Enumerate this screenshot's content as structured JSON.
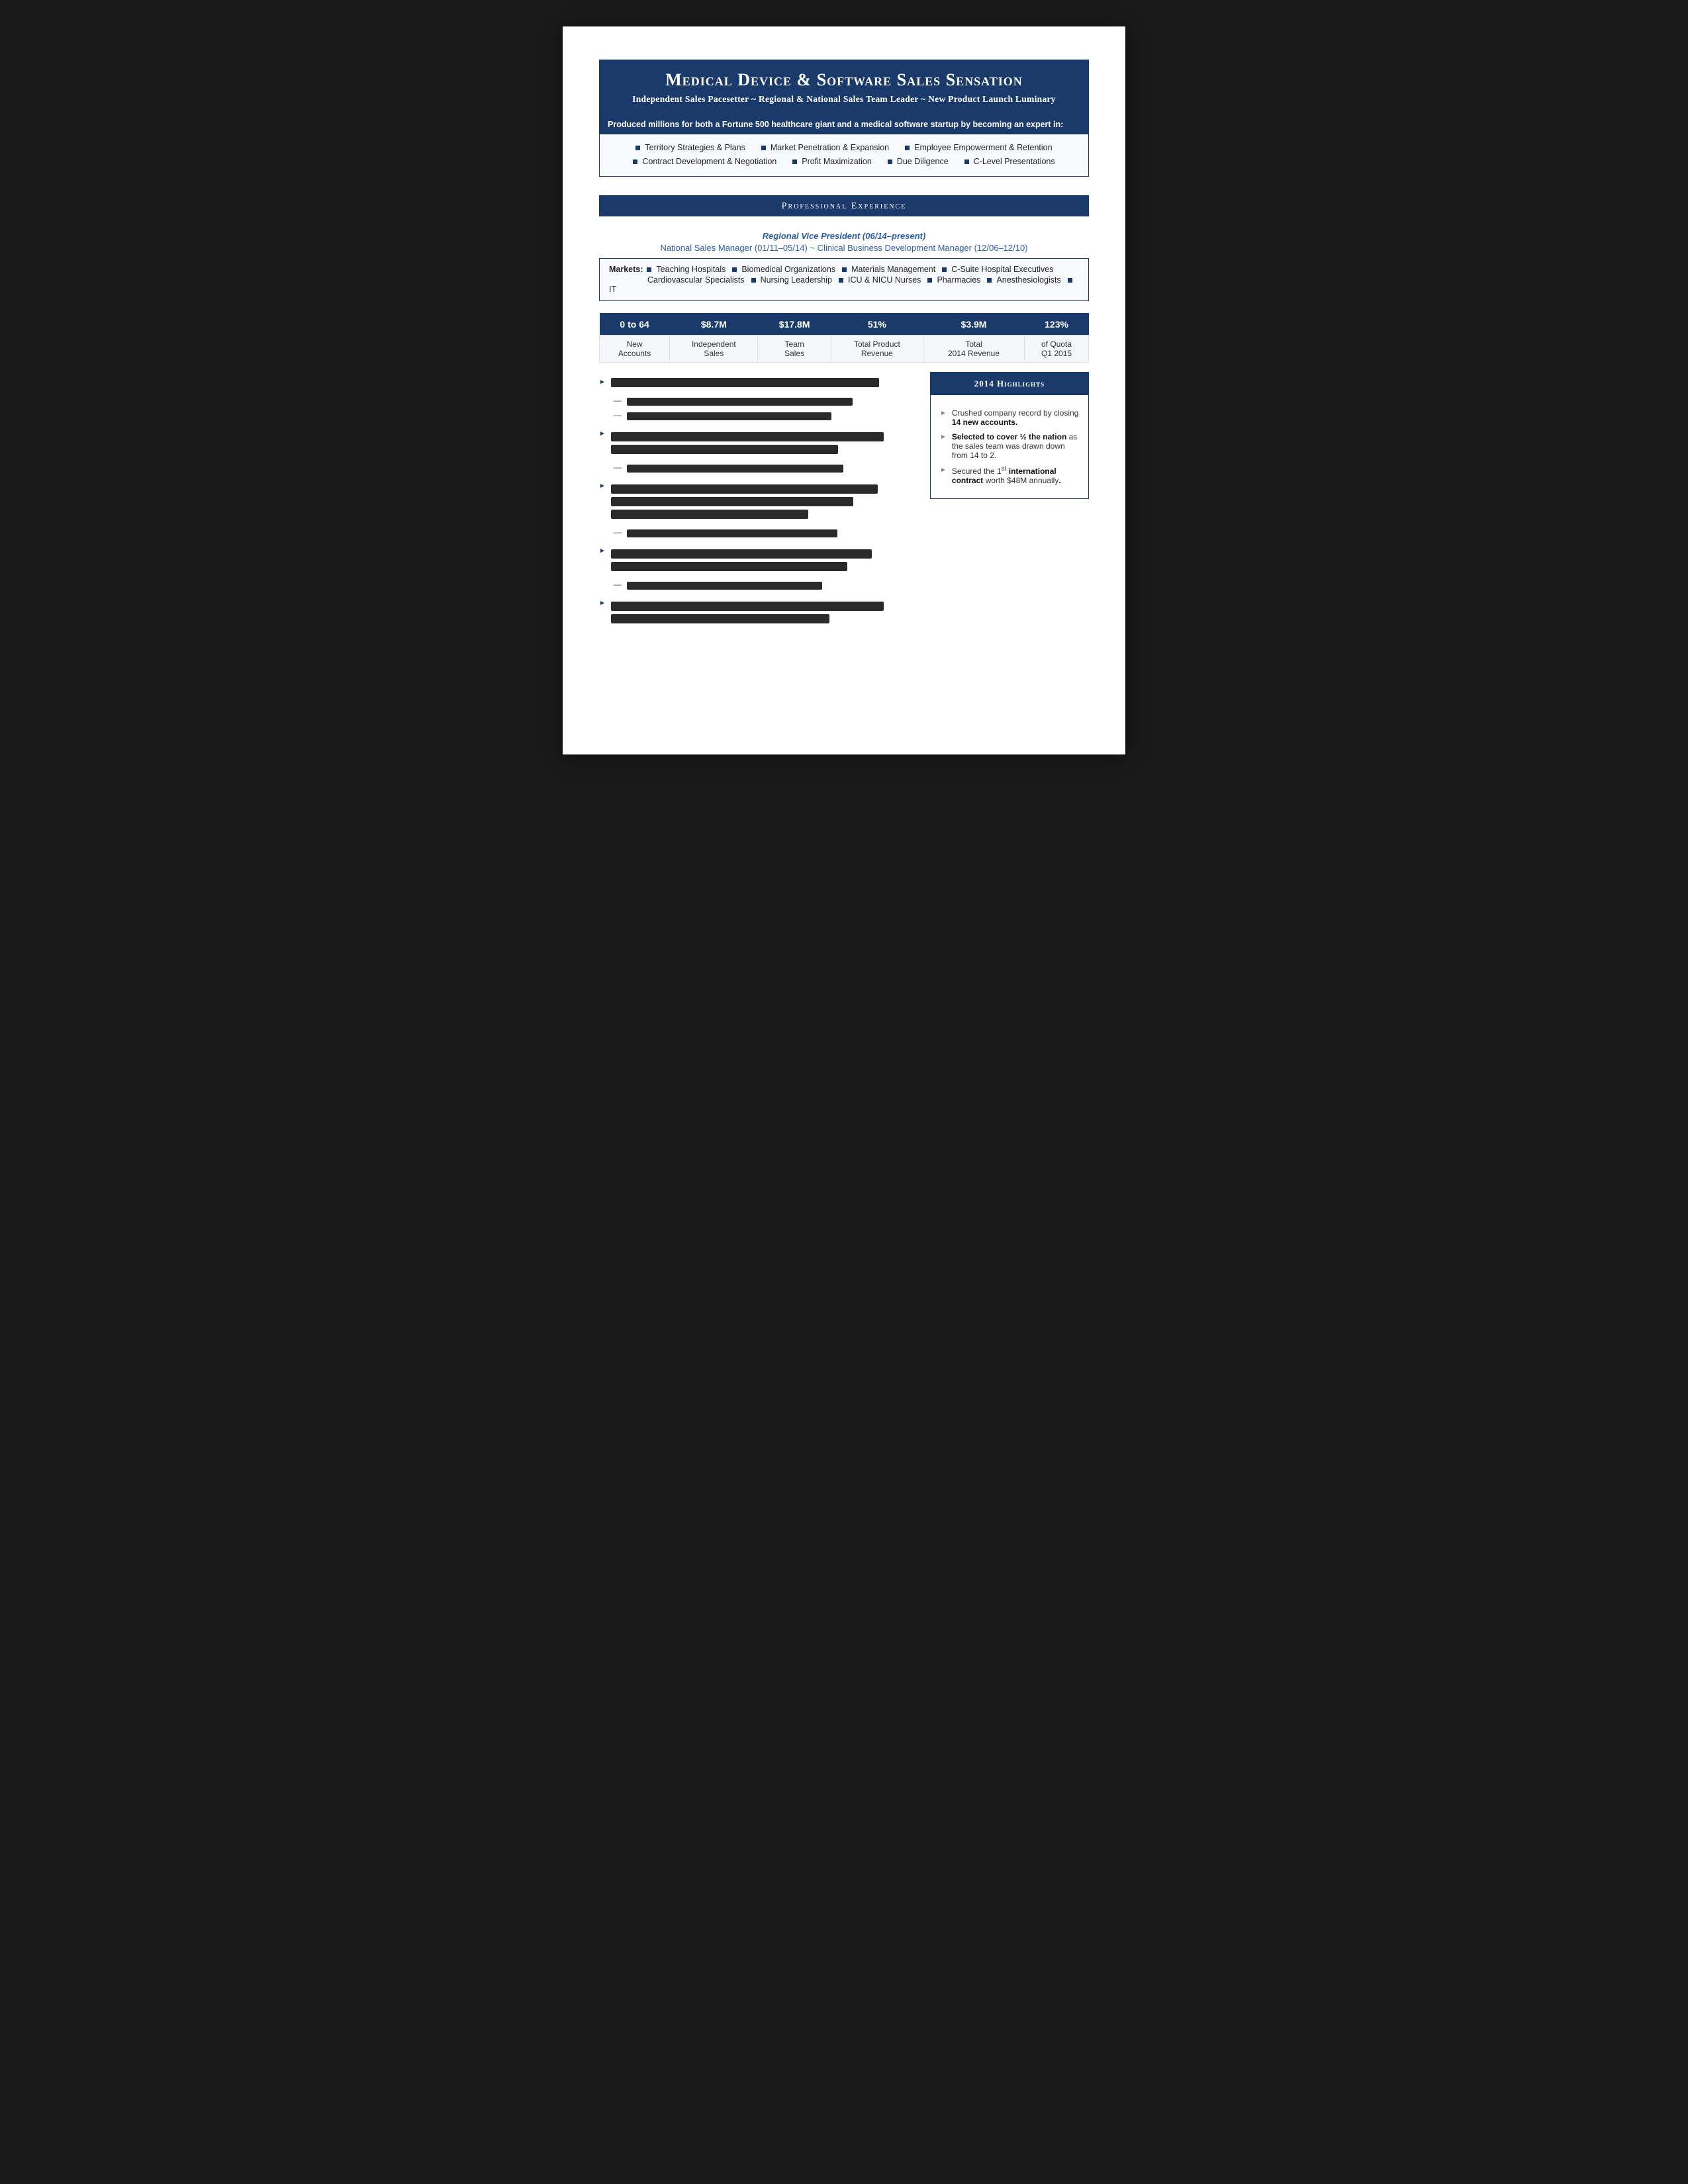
{
  "header": {
    "title": "Medical Device & Software Sales Sensation",
    "subtitle": "Independent Sales Pacesetter  ~  Regional & National Sales Team Leader  ~  New Product Launch Luminary"
  },
  "expert": {
    "intro": "Produced millions for both a Fortune 500 healthcare giant and a medical software startup by becoming an expert in:",
    "row1": [
      "Territory Strategies & Plans",
      "Market Penetration & Expansion",
      "Employee Empowerment & Retention"
    ],
    "row2": [
      "Contract Development & Negotiation",
      "Profit Maximization",
      "Due Diligence",
      "C-Level Presentations"
    ]
  },
  "section": {
    "professional_experience": "Professional Experience"
  },
  "jobs": {
    "title1": "Regional Vice President (06/14–present)",
    "title2": "National Sales Manager (01/11–05/14)  ~  Clinical Business Development Manager (12/06–12/10)"
  },
  "markets": {
    "label": "Markets:",
    "row1": [
      "Teaching Hospitals",
      "Biomedical Organizations",
      "Materials Management",
      "C-Suite Hospital Executives"
    ],
    "row2": [
      "Cardiovascular Specialists",
      "Nursing Leadership",
      "ICU & NICU Nurses",
      "Pharmacies",
      "Anesthesiologists",
      "IT"
    ]
  },
  "stats": {
    "headers": [
      "0 to 64",
      "$8.7M",
      "$17.8M",
      "51%",
      "$3.9M",
      "123%"
    ],
    "labels": [
      [
        "New",
        "Accounts"
      ],
      [
        "Independent",
        "Sales"
      ],
      [
        "Team",
        "Sales"
      ],
      [
        "Total Product",
        "Revenue"
      ],
      [
        "Total",
        "2014 Revenue"
      ],
      [
        "of Quota",
        "Q1 2015"
      ]
    ]
  },
  "highlights_2014": {
    "title": "2014 Highlights",
    "items": [
      {
        "text": "Crushed company record by closing ",
        "bold": "14 new accounts."
      },
      {
        "text": "",
        "bold": "Selected to cover ½ the nation",
        "text2": " as the sales team was drawn down from 14 to 2."
      },
      {
        "text": "Secured the 1",
        "sup": "st",
        "text3": " ",
        "bold": "international contract",
        "text4": " worth $48M annually."
      }
    ]
  }
}
